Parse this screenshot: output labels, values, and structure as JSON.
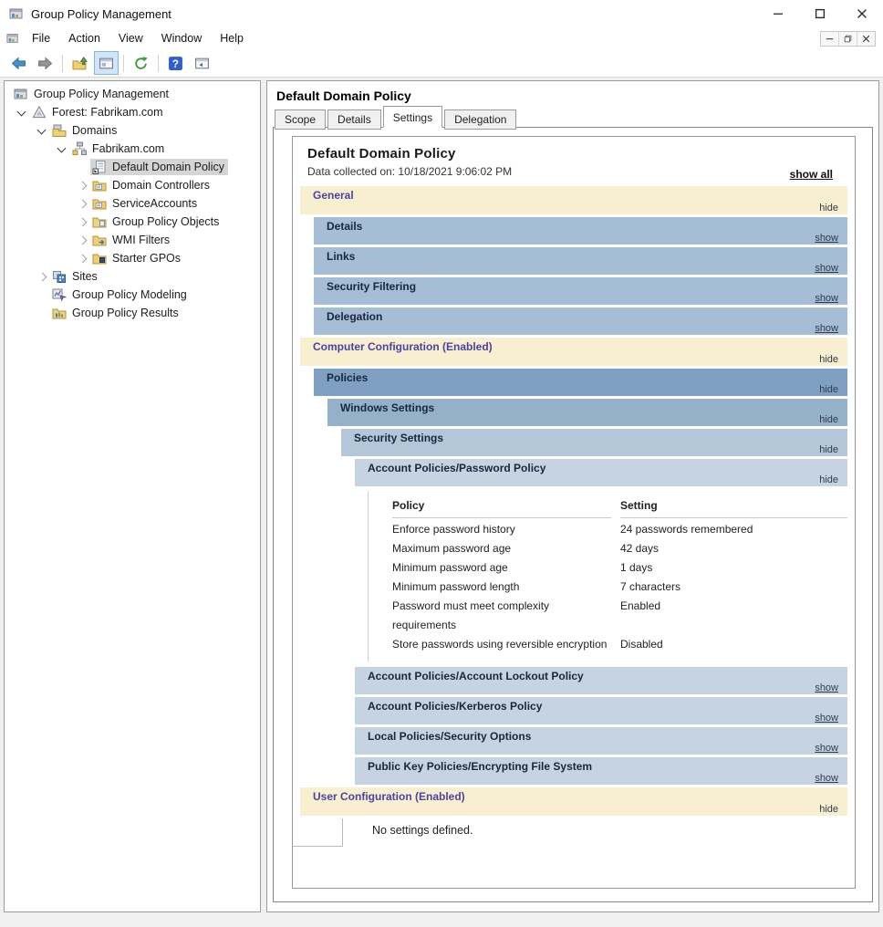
{
  "window": {
    "title": "Group Policy Management",
    "controls": [
      {
        "name": "minimize-button",
        "icon": "minimize-icon"
      },
      {
        "name": "maximize-button",
        "icon": "maximize-icon"
      },
      {
        "name": "close-button",
        "icon": "close-icon"
      }
    ]
  },
  "menubar": {
    "items": [
      "File",
      "Action",
      "View",
      "Window",
      "Help"
    ],
    "child_controls": [
      {
        "name": "child-minimize-button",
        "icon": "minimize-icon"
      },
      {
        "name": "child-restore-button",
        "icon": "restore-icon"
      },
      {
        "name": "child-close-button",
        "icon": "close-icon"
      }
    ]
  },
  "toolbar": {
    "buttons": [
      {
        "icon": "back-arrow-icon"
      },
      {
        "icon": "forward-arrow-icon"
      },
      {
        "sep": true
      },
      {
        "icon": "export-list-icon"
      },
      {
        "icon": "console-window-icon",
        "active": true
      },
      {
        "sep": true
      },
      {
        "icon": "refresh-icon"
      },
      {
        "sep": true
      },
      {
        "icon": "help-icon"
      },
      {
        "icon": "new-window-icon"
      }
    ]
  },
  "sidebar": {
    "items": [
      {
        "label": "Group Policy Management",
        "icon": "gpmc-console-icon",
        "indent": 0,
        "chevron": null,
        "selected": false
      },
      {
        "label": "Forest: Fabrikam.com",
        "icon": "forest-icon",
        "indent": 1,
        "chevron": "open",
        "selected": false
      },
      {
        "label": "Domains",
        "icon": "domains-icon",
        "indent": 2,
        "chevron": "open",
        "selected": false
      },
      {
        "label": "Fabrikam.com",
        "icon": "domain-icon",
        "indent": 3,
        "chevron": "open",
        "selected": false
      },
      {
        "label": "Default Domain Policy",
        "icon": "gpo-link-icon",
        "indent": 4,
        "chevron": null,
        "selected": true
      },
      {
        "label": "Domain Controllers",
        "icon": "ou-folder-icon",
        "indent": 4,
        "chevron": "closed",
        "selected": false
      },
      {
        "label": "ServiceAccounts",
        "icon": "ou-folder-icon",
        "indent": 4,
        "chevron": "closed",
        "selected": false
      },
      {
        "label": "Group Policy Objects",
        "icon": "gpo-folder-icon",
        "indent": 4,
        "chevron": "closed",
        "selected": false
      },
      {
        "label": "WMI Filters",
        "icon": "wmi-filter-icon",
        "indent": 4,
        "chevron": "closed",
        "selected": false
      },
      {
        "label": "Starter GPOs",
        "icon": "starter-gpo-icon",
        "indent": 4,
        "chevron": "closed",
        "selected": false
      },
      {
        "label": "Sites",
        "icon": "sites-icon",
        "indent": 2,
        "chevron": "closed",
        "selected": false
      },
      {
        "label": "Group Policy Modeling",
        "icon": "modeling-icon",
        "indent": 2,
        "chevron": null,
        "selected": false
      },
      {
        "label": "Group Policy Results",
        "icon": "results-icon",
        "indent": 2,
        "chevron": null,
        "selected": false
      }
    ]
  },
  "content": {
    "title": "Default Domain Policy",
    "tabs": [
      {
        "label": "Scope",
        "active": false
      },
      {
        "label": "Details",
        "active": false
      },
      {
        "label": "Settings",
        "active": true
      },
      {
        "label": "Delegation",
        "active": false
      }
    ],
    "report": {
      "title": "Default Domain Policy",
      "collected": "Data collected on: 10/18/2021 9:06:02 PM",
      "show_all_label": "show all",
      "items": [
        {
          "kind": "section",
          "label": "General",
          "action": "hide"
        },
        {
          "kind": "band",
          "level": 1,
          "tone": "gen",
          "label": "Details",
          "action": "show"
        },
        {
          "kind": "band",
          "level": 1,
          "tone": "gen",
          "label": "Links",
          "action": "show"
        },
        {
          "kind": "band",
          "level": 1,
          "tone": "gen",
          "label": "Security Filtering",
          "action": "show"
        },
        {
          "kind": "band",
          "level": 1,
          "tone": "gen",
          "label": "Delegation",
          "action": "show"
        },
        {
          "kind": "section",
          "label": "Computer Configuration (Enabled)",
          "action": "hide"
        },
        {
          "kind": "band",
          "level": 1,
          "tone": "d1",
          "label": "Policies",
          "action": "hide"
        },
        {
          "kind": "band",
          "level": 2,
          "tone": "d2",
          "label": "Windows Settings",
          "action": "hide"
        },
        {
          "kind": "band",
          "level": 3,
          "tone": "d3",
          "label": "Security Settings",
          "action": "hide"
        },
        {
          "kind": "band",
          "level": 4,
          "tone": "d4",
          "label": "Account Policies/Password Policy",
          "action": "hide"
        },
        {
          "kind": "table",
          "headers": [
            "Policy",
            "Setting"
          ],
          "rows": [
            [
              "Enforce password history",
              "24 passwords remembered"
            ],
            [
              "Maximum password age",
              "42 days"
            ],
            [
              "Minimum password age",
              "1 days"
            ],
            [
              "Minimum password length",
              "7 characters"
            ],
            [
              "Password must meet complexity requirements",
              "Enabled"
            ],
            [
              "Store passwords using reversible encryption",
              "Disabled"
            ]
          ]
        },
        {
          "kind": "band",
          "level": 4,
          "tone": "d4",
          "label": "Account Policies/Account Lockout Policy",
          "action": "show"
        },
        {
          "kind": "band",
          "level": 4,
          "tone": "d4",
          "label": "Account Policies/Kerberos Policy",
          "action": "show"
        },
        {
          "kind": "band",
          "level": 4,
          "tone": "d4",
          "label": "Local Policies/Security Options",
          "action": "show"
        },
        {
          "kind": "band",
          "level": 4,
          "tone": "d4",
          "label": "Public Key Policies/Encrypting File System",
          "action": "show"
        },
        {
          "kind": "section",
          "label": "User Configuration (Enabled)",
          "action": "hide"
        },
        {
          "kind": "norow",
          "text": "No settings defined."
        }
      ]
    }
  },
  "colors": {
    "section_bg": "#f7efcf",
    "section_text": "#4b42a5",
    "band_gen": "#a6bdd6",
    "band_d1": "#7fa0c2",
    "band_d2": "#95b1ca",
    "band_d3": "#b4c7d8",
    "band_d4": "#c6d4e1"
  }
}
